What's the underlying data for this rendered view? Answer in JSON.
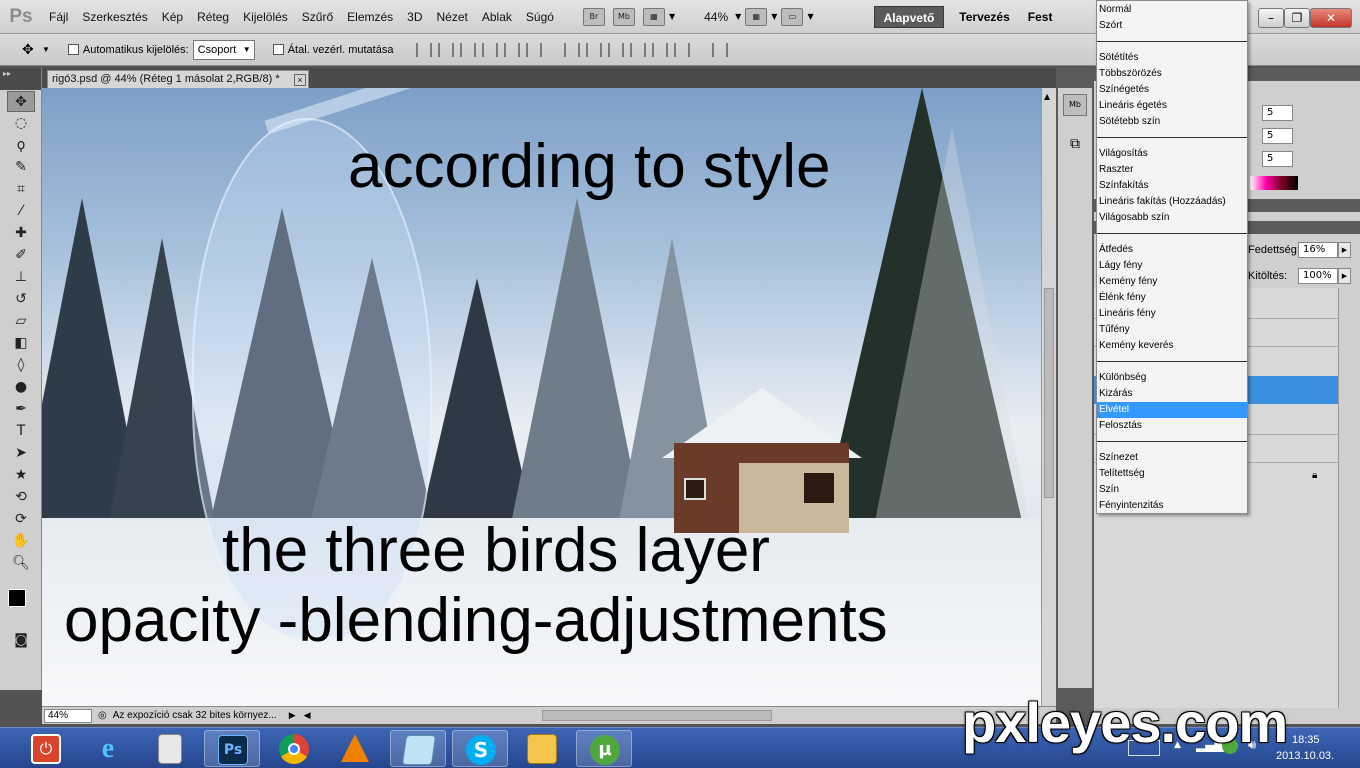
{
  "app": {
    "logo": "Ps"
  },
  "menubar": {
    "items": [
      "Fájl",
      "Szerkesztés",
      "Kép",
      "Réteg",
      "Kijelölés",
      "Szűrő",
      "Elemzés",
      "3D",
      "Nézet",
      "Ablak",
      "Súgó"
    ],
    "toolbar_icons": [
      {
        "label": "Br",
        "icon": "bridge-icon"
      },
      {
        "label": "Mb",
        "icon": "minibridge-icon"
      }
    ],
    "zoom": "44%",
    "workspaces": [
      "Alapvető",
      "Tervezés",
      "Fest"
    ],
    "active_workspace": "Alapvető"
  },
  "options": {
    "auto_select_label": "Automatikus kijelölés:",
    "auto_select_value": "Csoport",
    "transform_label": "Átal. vezérl. mutatása"
  },
  "document": {
    "tab_title": "rigó3.psd @ 44% (Réteg 1 másolat 2,RGB/8) *",
    "close_glyph": "×",
    "canvas_text_1": "according to style",
    "canvas_text_2": "the three birds layer",
    "canvas_text_3": "opacity -blending-adjustments"
  },
  "statusbar": {
    "zoom": "44%",
    "message": "Az expozíció csak 32 bites környez..."
  },
  "color_panel": {
    "r": "5",
    "g": "5",
    "b": "5"
  },
  "layers_panel": {
    "opacity_label": "Fedettség:",
    "opacity_value": "16%",
    "fill_label": "Kitöltés:",
    "fill_value": "100%"
  },
  "blend_menu": {
    "groups": [
      [
        "Normál",
        "Szórt"
      ],
      [
        "Sötétítés",
        "Többszörözés",
        "Színégetés",
        "Lineáris égetés",
        "Sötétebb szín"
      ],
      [
        "Világosítás",
        "Raszter",
        "Színfakítás",
        "Lineáris fakítás (Hozzáadás)",
        "Világosabb szín"
      ],
      [
        "Átfedés",
        "Lágy fény",
        "Kemény fény",
        "Élénk fény",
        "Lineáris fény",
        "Tűfény",
        "Kemény keverés"
      ],
      [
        "Különbség",
        "Kizárás",
        "Elvétel",
        "Felosztás"
      ],
      [
        "Színezet",
        "Telítettség",
        "Szín",
        "Fényintenzitás"
      ]
    ],
    "selected": "Elvétel"
  },
  "taskbar": {
    "apps": [
      "power-icon",
      "internet-explorer-icon",
      "calculator-icon",
      "photoshop-icon",
      "chrome-icon",
      "vlc-icon",
      "notepad-icon",
      "skype-icon",
      "file-explorer-icon",
      "utorrent-icon"
    ],
    "running": "photoshop-icon",
    "ps_label": "Ps",
    "date": "2013.10.03.",
    "time": "18:35"
  },
  "watermark": "pxleyes.com",
  "colors": {
    "selection": "#3399ff",
    "taskbar": "#2c4f9c",
    "workspace_active": "#5b5b5b"
  }
}
